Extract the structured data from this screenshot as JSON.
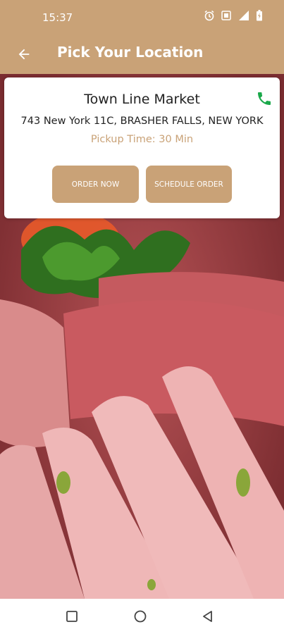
{
  "status_bar": {
    "time": "15:37",
    "icons": [
      "alarm-icon",
      "vibrate-icon",
      "signal-icon",
      "battery-icon"
    ]
  },
  "app_bar": {
    "title": "Pick Your Location",
    "back_icon": "arrow-back-icon"
  },
  "store": {
    "name": "Town Line Market",
    "address": "743 New York 11C, BRASHER FALLS, NEW YORK",
    "pickup_time": "Pickup Time: 30 Min",
    "phone_icon": "phone-icon"
  },
  "buttons": {
    "order_now": "ORDER NOW",
    "schedule_order": "SCHEDULE ORDER"
  },
  "nav_bar": {
    "icons": [
      "recent-apps-icon",
      "home-icon",
      "back-icon"
    ]
  },
  "colors": {
    "primary": "#c9a277",
    "phone_green": "#1aa84a",
    "text": "#222222"
  }
}
